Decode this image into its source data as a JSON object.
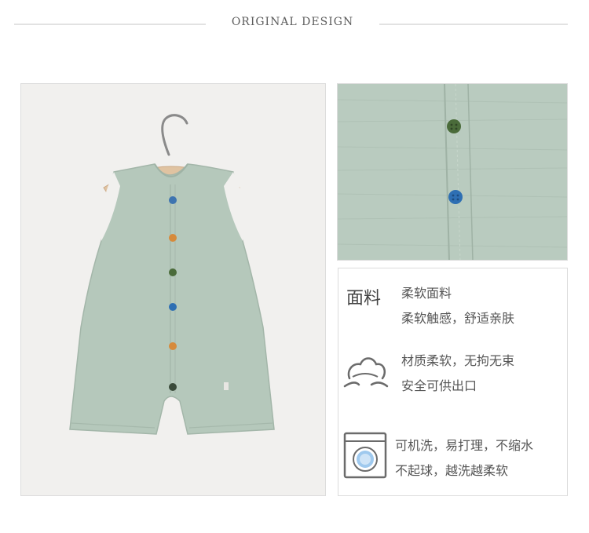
{
  "header": {
    "title": "ORIGINAL DESIGN"
  },
  "colors": {
    "garment": "#b5c8bb",
    "background": "#f1f0ee",
    "rule": "#e2e2e2",
    "text": "#555555",
    "buttons": [
      "#3e74b0",
      "#d68a3b",
      "#4a6b3a",
      "#2e6fb3",
      "#d68a3b",
      "#3a4a3a"
    ]
  },
  "features": {
    "fabric": {
      "label": "面料",
      "line1": "柔软面料",
      "line2": "柔软触感，舒适亲肤"
    },
    "comfort": {
      "icon": "soft-cloth-icon",
      "line1": "材质柔软，无拘无束",
      "line2": "安全可供出口"
    },
    "wash": {
      "icon": "washing-machine-icon",
      "line1": "可机洗，易打理，不缩水",
      "line2": "不起球，越洗越柔软"
    }
  }
}
